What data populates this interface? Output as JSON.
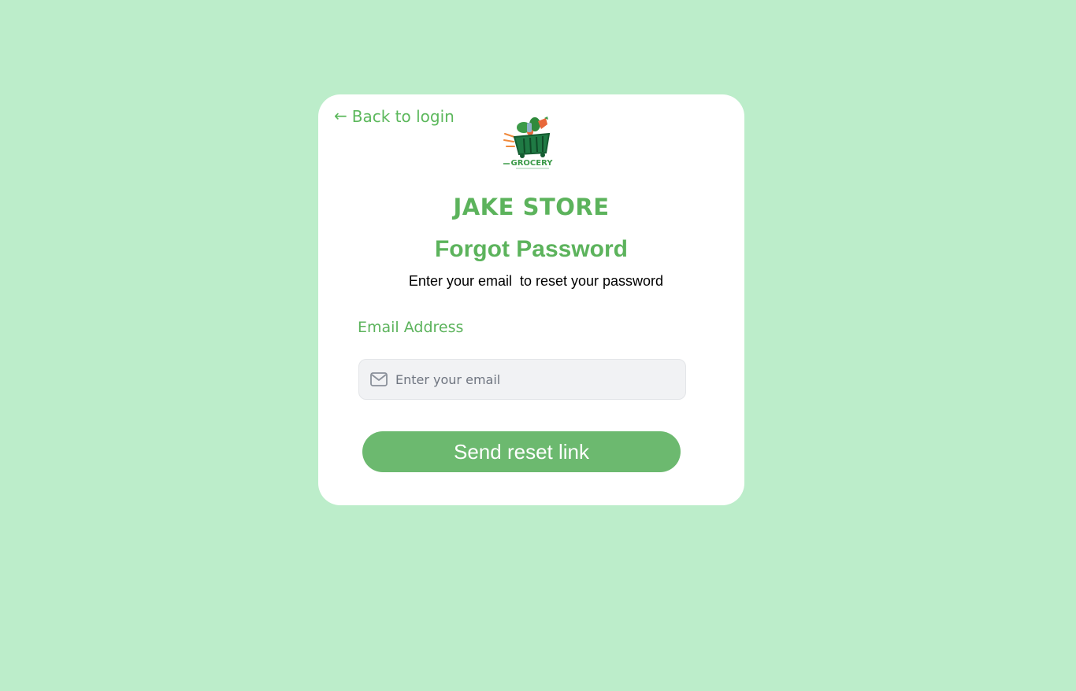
{
  "nav": {
    "back_arrow": "←",
    "back_label": "Back to login"
  },
  "logo": {
    "icon": "grocery-basket-logo",
    "text": "GROCERY"
  },
  "store_name": "JAKE STORE",
  "title": "Forgot Password",
  "subtitle": "Enter your email  to reset your password",
  "form": {
    "email_label": "Email Address",
    "email_placeholder": "Enter your email",
    "email_value": "",
    "email_icon": "mail-icon",
    "submit_label": "Send reset link"
  },
  "colors": {
    "background": "#bcedca",
    "card": "#ffffff",
    "accent": "#5cb35c",
    "button": "#6cb96f"
  }
}
